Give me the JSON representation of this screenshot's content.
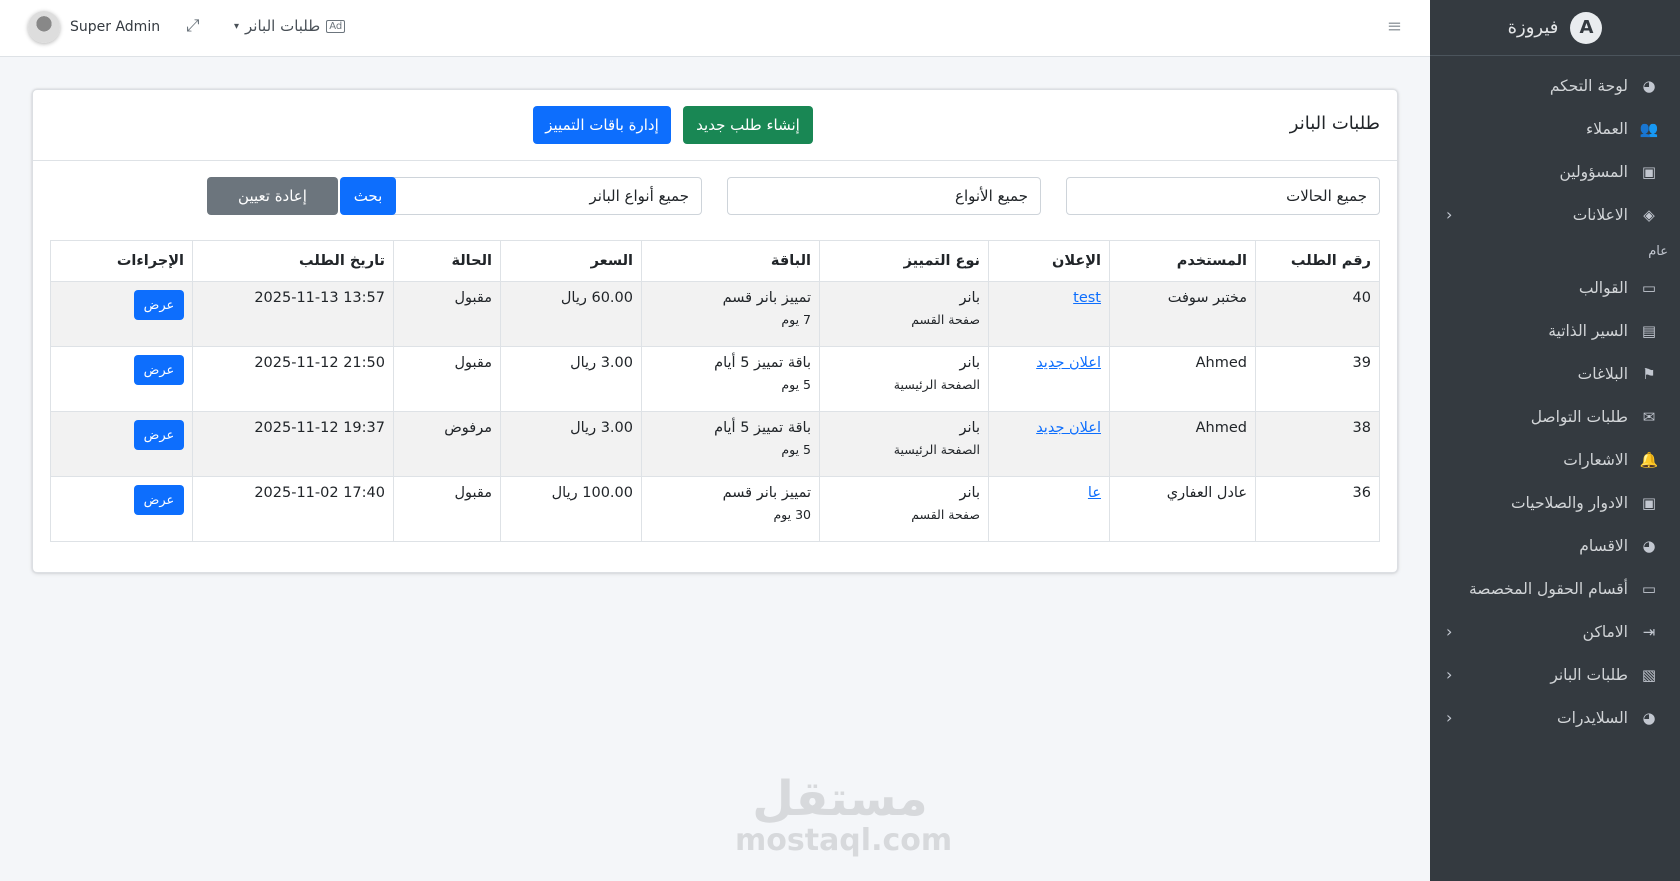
{
  "sidebar": {
    "brand": "فيروزة",
    "items": [
      {
        "label": "لوحة التحكم",
        "icon": "palette-icon",
        "glyph": "◕",
        "chevron": false
      },
      {
        "label": "العملاء",
        "icon": "users-icon",
        "glyph": "👥",
        "chevron": false
      },
      {
        "label": "المسؤولين",
        "icon": "id-card-icon",
        "glyph": "▣",
        "chevron": false
      },
      {
        "label": "الاعلانات",
        "icon": "box-icon",
        "glyph": "◈",
        "chevron": true
      }
    ],
    "section_header": "عام",
    "items2": [
      {
        "label": "القوالب",
        "icon": "folder-icon",
        "glyph": "▭",
        "chevron": false
      },
      {
        "label": "السير الذاتية",
        "icon": "person-file-icon",
        "glyph": "▤",
        "chevron": false
      },
      {
        "label": "البلاغات",
        "icon": "flag-icon",
        "glyph": "⚑",
        "chevron": false
      },
      {
        "label": "طلبات التواصل",
        "icon": "envelope-icon",
        "glyph": "✉",
        "chevron": false
      },
      {
        "label": "الاشعارات",
        "icon": "bell-icon",
        "glyph": "🔔",
        "chevron": false
      },
      {
        "label": "الادوار والصلاحيات",
        "icon": "badge-icon",
        "glyph": "▣",
        "chevron": false
      },
      {
        "label": "الاقسام",
        "icon": "palette-icon",
        "glyph": "◕",
        "chevron": false
      },
      {
        "label": "أقسام الحقول المخصصة",
        "icon": "folder-plus-icon",
        "glyph": "▭",
        "chevron": false
      },
      {
        "label": "الاماكن",
        "icon": "sign-in-icon",
        "glyph": "⇥",
        "chevron": true
      },
      {
        "label": "طلبات البانر",
        "icon": "ad-icon",
        "glyph": "▧",
        "chevron": true
      },
      {
        "label": "السلايدرات",
        "icon": "palette-icon",
        "glyph": "◕",
        "chevron": true
      }
    ],
    "chevron_glyph": "‹"
  },
  "topbar": {
    "user_name": "Super Admin",
    "page_link": "طلبات البانر",
    "ad_badge": "Ad",
    "expand_glyph": "⤢",
    "menu_glyph": "≡",
    "caret_glyph": "▾"
  },
  "card": {
    "title": "طلبات البانر",
    "create_button": "إنشاء طلب جديد",
    "manage_button": "إدارة باقات التمييز"
  },
  "filters": {
    "status": "جميع الحالات",
    "types": "جميع الأنواع",
    "banner_types": "جميع أنواع البانر",
    "search_button": "بحث",
    "reset_button": "إعادة تعيين"
  },
  "table": {
    "headers": [
      "رقم الطلب",
      "المستخدم",
      "الإعلان",
      "نوع التمييز",
      "الباقة",
      "السعر",
      "الحالة",
      "تاريخ الطلب",
      "الإجراءات"
    ],
    "view_label": "عرض",
    "rows": [
      {
        "id": "40",
        "user": "مختبر سوفت",
        "ad": "test",
        "type": "بانر",
        "type_sub": "صفحة القسم",
        "package": "تمييز بانر قسم",
        "package_sub": "7 يوم",
        "price": "60.00 ريال",
        "status": "مقبول",
        "date": "2025-11-13 13:57"
      },
      {
        "id": "39",
        "user": "Ahmed",
        "ad": "اعلان جديد",
        "type": "بانر",
        "type_sub": "الصفحة الرئيسية",
        "package": "باقة تمييز 5 أيام",
        "package_sub": "5 يوم",
        "price": "3.00 ريال",
        "status": "مقبول",
        "date": "2025-11-12 21:50"
      },
      {
        "id": "38",
        "user": "Ahmed",
        "ad": "اعلان جديد",
        "type": "بانر",
        "type_sub": "الصفحة الرئيسية",
        "package": "باقة تمييز 5 أيام",
        "package_sub": "5 يوم",
        "price": "3.00 ريال",
        "status": "مرفوض",
        "date": "2025-11-12 19:37"
      },
      {
        "id": "36",
        "user": "عادل العفاري",
        "ad": "عا",
        "type": "بانر",
        "type_sub": "صفحة القسم",
        "package": "تمييز بانر قسم",
        "package_sub": "30 يوم",
        "price": "100.00 ريال",
        "status": "مقبول",
        "date": "2025-11-02 17:40"
      }
    ]
  },
  "watermark": {
    "arabic": "مستقل",
    "latin": "mostaql.com"
  }
}
